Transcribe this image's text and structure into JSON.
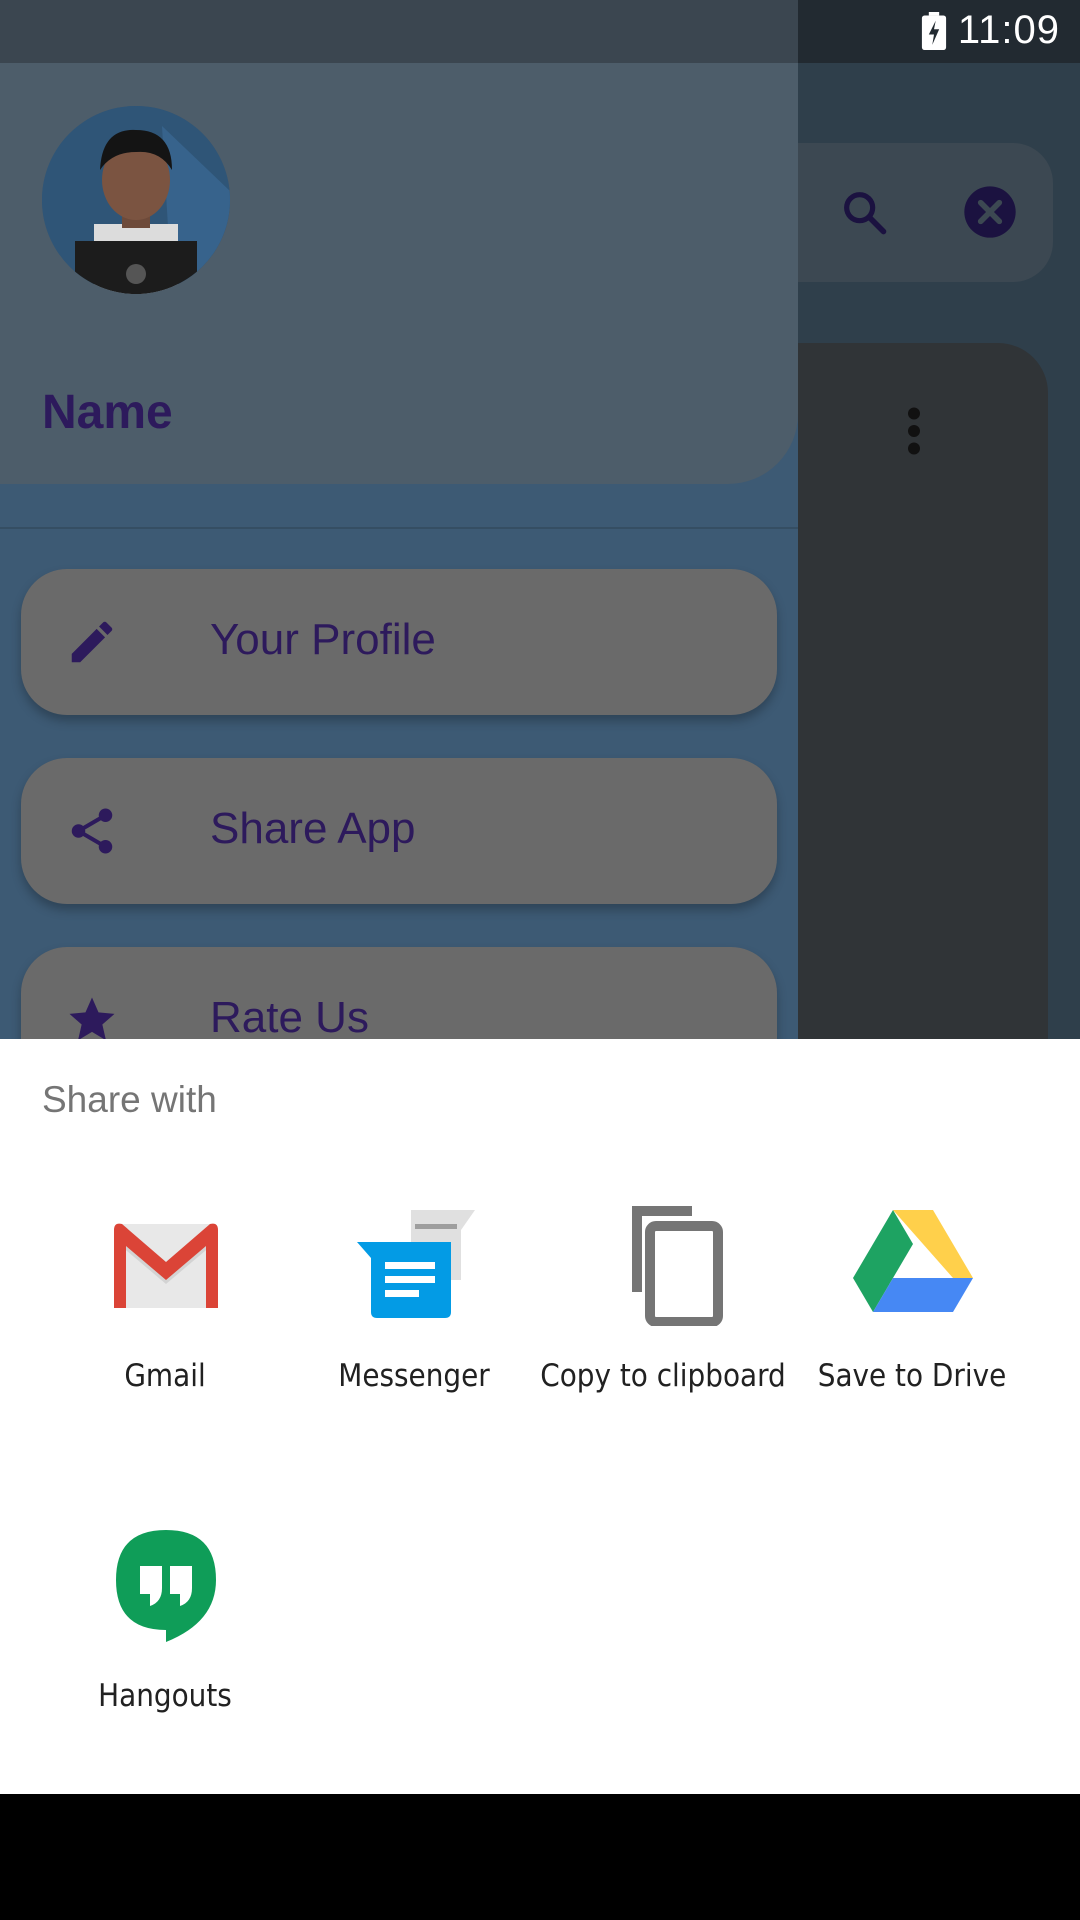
{
  "status_bar": {
    "time": "11:09"
  },
  "drawer": {
    "name": "Name",
    "menu_items": [
      {
        "label": "Your Profile",
        "icon": "edit-icon"
      },
      {
        "label": "Share App",
        "icon": "share-icon"
      },
      {
        "label": "Rate Us",
        "icon": "star-icon"
      }
    ]
  },
  "share_sheet": {
    "title": "Share with",
    "targets": [
      {
        "label": "Gmail",
        "icon": "gmail-icon"
      },
      {
        "label": "Messenger",
        "icon": "messenger-icon"
      },
      {
        "label": "Copy to clipboard",
        "icon": "copy-icon"
      },
      {
        "label": "Save to Drive",
        "icon": "drive-icon"
      },
      {
        "label": "Hangouts",
        "icon": "hangouts-icon"
      }
    ]
  },
  "colors": {
    "drawer_text": "#2d1a5c",
    "sheet_background": "#ffffff",
    "menu_item_background": "#6a6a6a"
  }
}
